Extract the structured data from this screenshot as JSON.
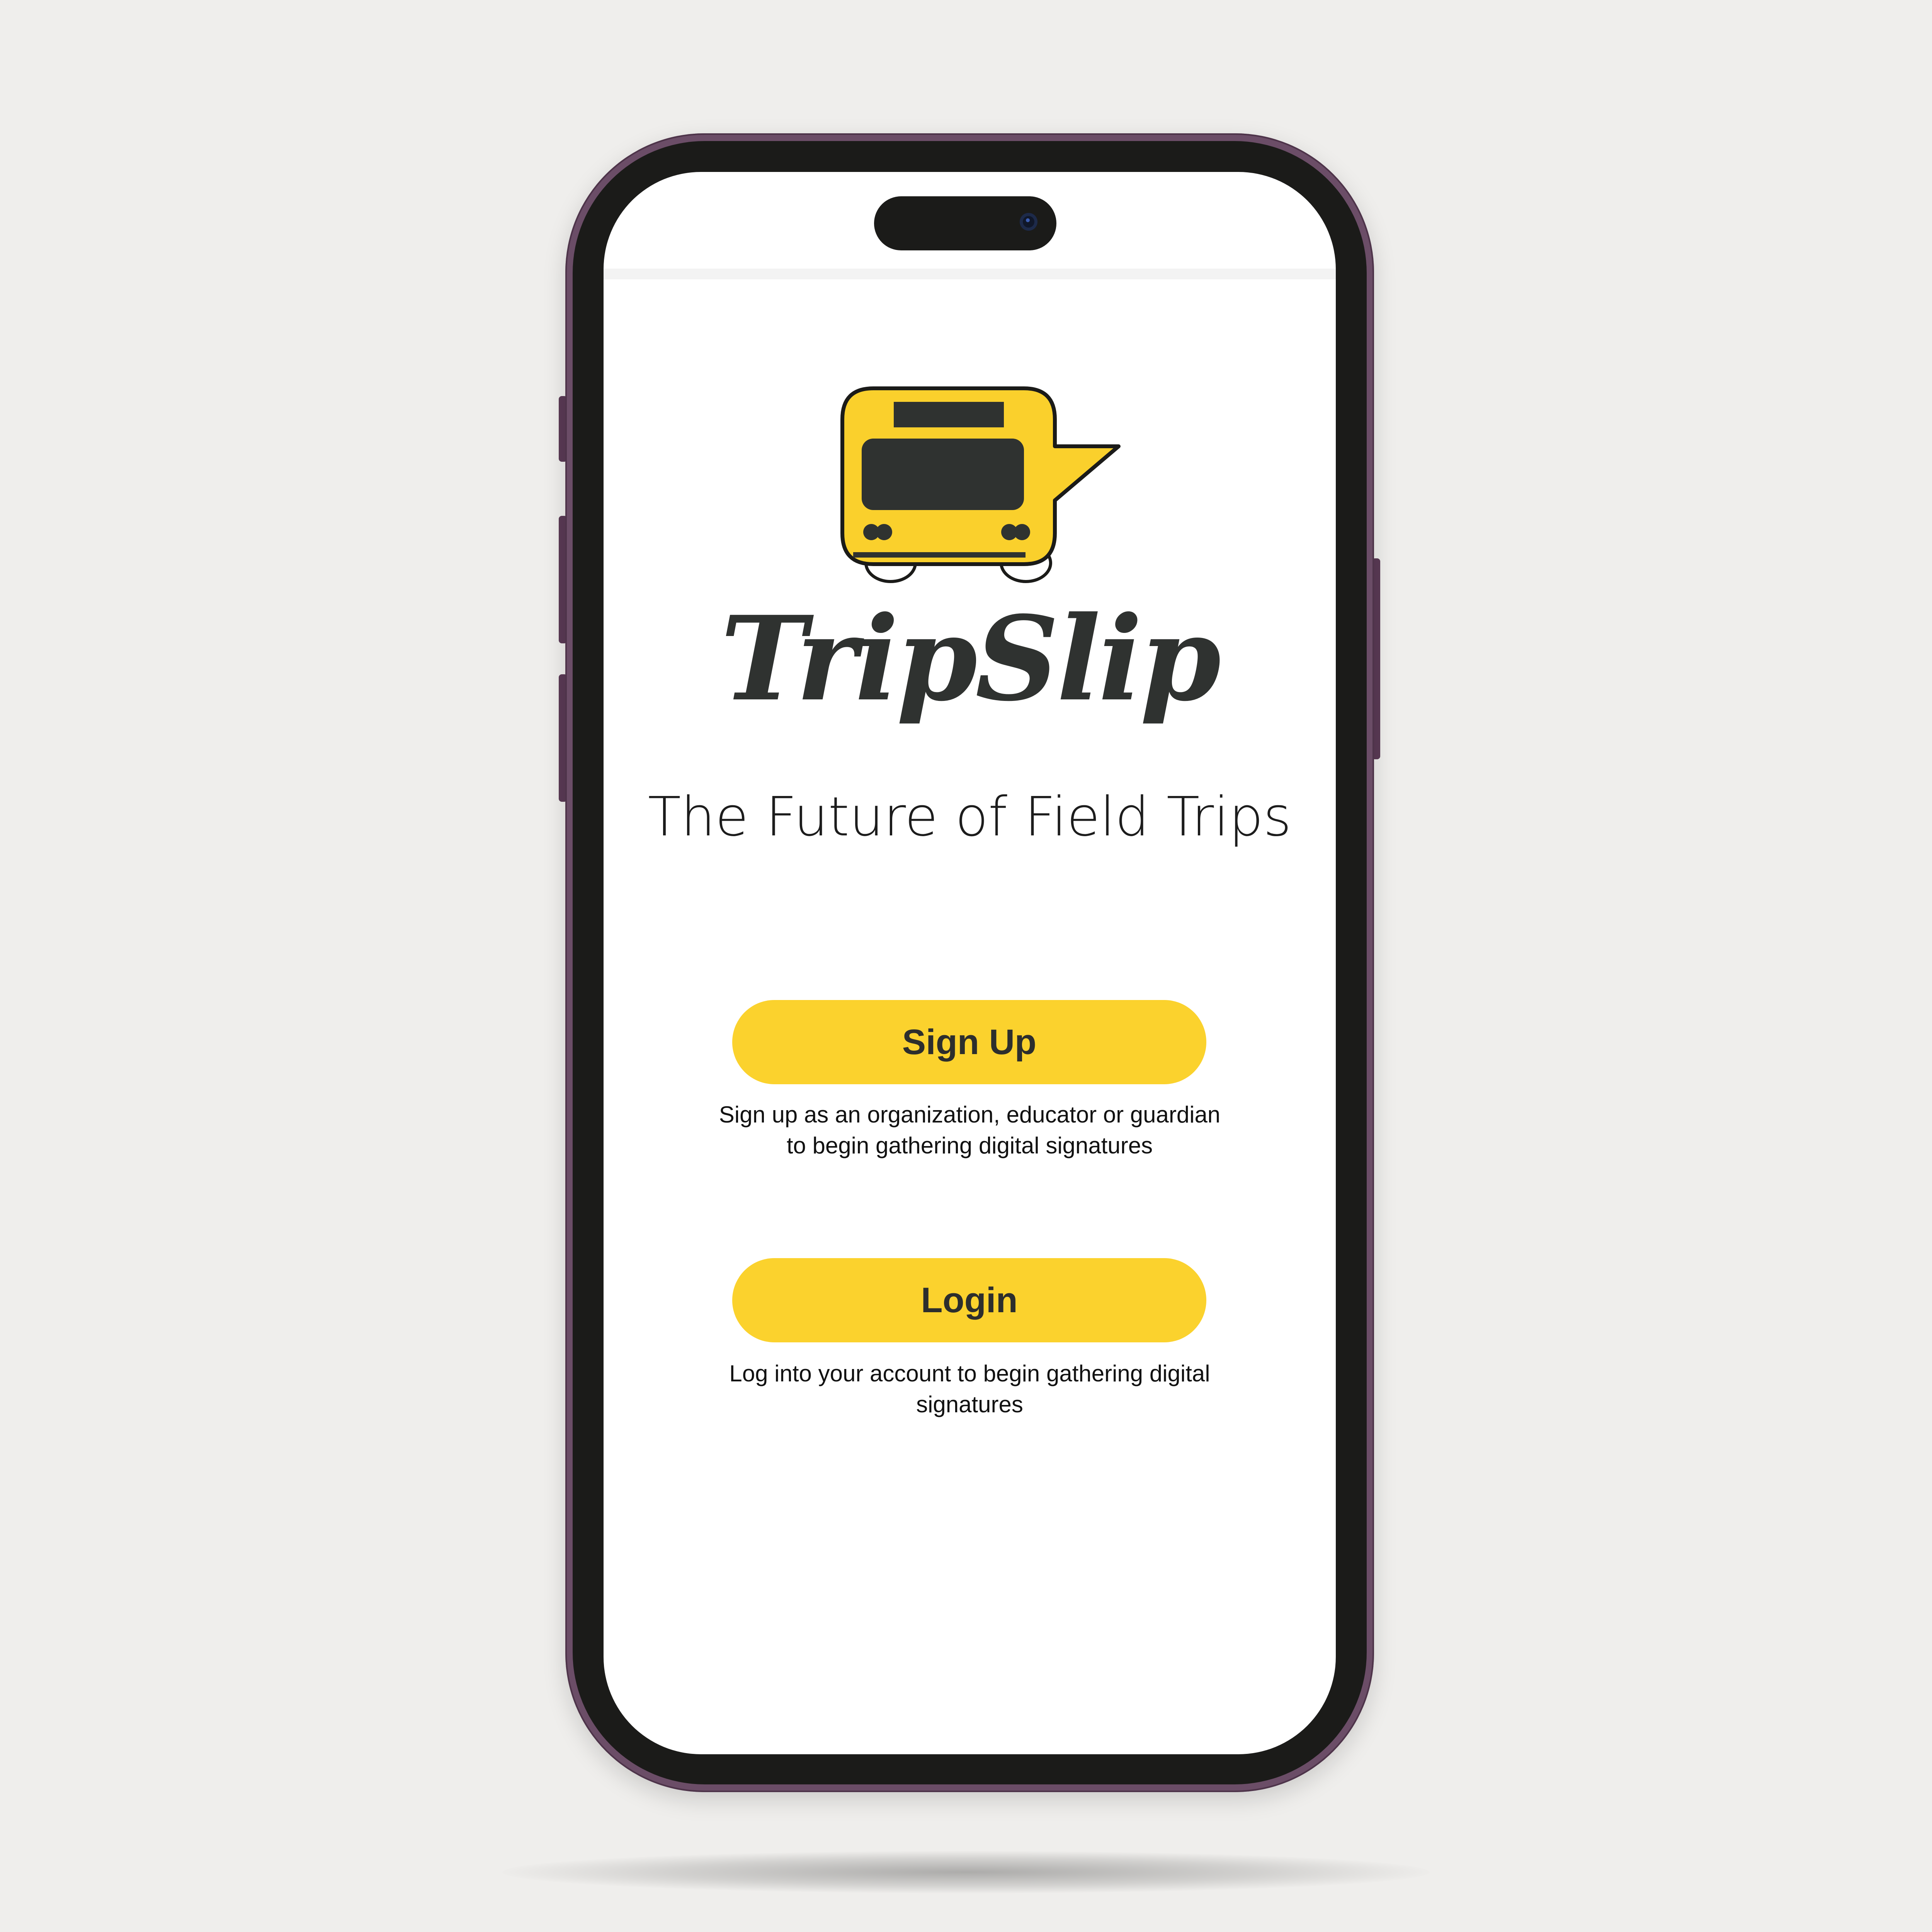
{
  "app": {
    "brand_name": "TripSlip",
    "tagline": "The Future of Field Trips"
  },
  "signup": {
    "button_label": "Sign Up",
    "description": "Sign up as an organization, educator or guardian to begin gathering digital signatures"
  },
  "login": {
    "button_label": "Login",
    "description": "Log into your account to begin gathering digital signatures"
  },
  "colors": {
    "accent": "#fbd22d",
    "bus_yellow": "#fad02c",
    "text_dark": "#2f3230",
    "phone_frame": "#6b4d67",
    "background": "#efeeec"
  },
  "icons": {
    "logo": "school-bus-speech-bubble-icon"
  }
}
